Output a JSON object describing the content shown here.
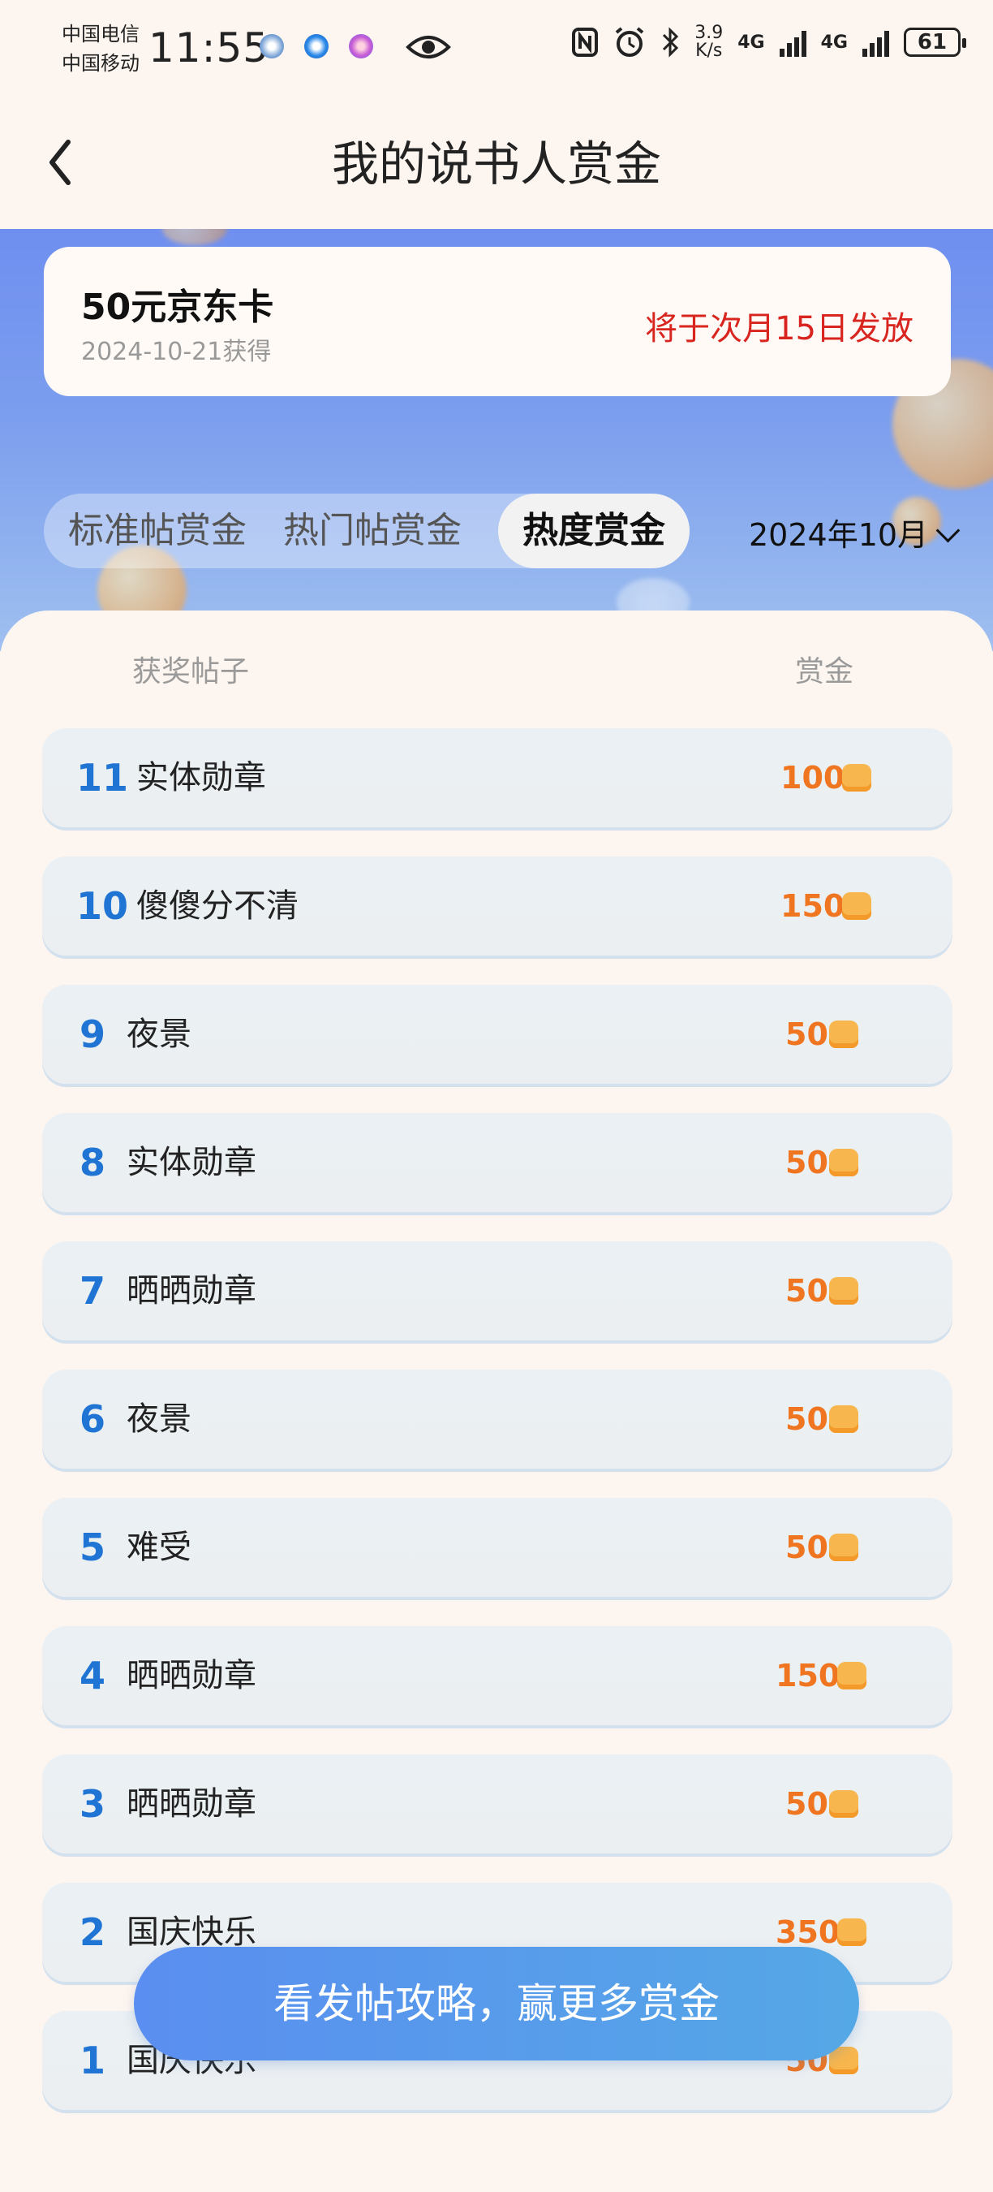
{
  "status_bar": {
    "carrier_1": "中国电信",
    "carrier_2": "中国移动",
    "time": "11:55",
    "net_speed_value": "3.9",
    "net_speed_unit": "K/s",
    "network_1": "4G",
    "network_2": "4G",
    "battery": "61"
  },
  "header": {
    "title": "我的说书人赏金"
  },
  "prize_card": {
    "title": "50元京东卡",
    "date": "2024-10-21获得",
    "status": "将于次月15日发放"
  },
  "tabs": [
    {
      "label": "标准帖赏金",
      "active": false
    },
    {
      "label": "热门帖赏金",
      "active": false
    },
    {
      "label": "热度赏金",
      "active": true
    }
  ],
  "month_selector": "2024年10月",
  "table_headers": {
    "post": "获奖帖子",
    "reward": "赏金"
  },
  "rows": [
    {
      "rank": "11",
      "title": "实体勋章",
      "reward": "100"
    },
    {
      "rank": "10",
      "title": "傻傻分不清",
      "reward": "150"
    },
    {
      "rank": "9",
      "title": "夜景",
      "reward": "50"
    },
    {
      "rank": "8",
      "title": "实体勋章",
      "reward": "50"
    },
    {
      "rank": "7",
      "title": "晒晒勋章",
      "reward": "50"
    },
    {
      "rank": "6",
      "title": "夜景",
      "reward": "50"
    },
    {
      "rank": "5",
      "title": "难受",
      "reward": "50"
    },
    {
      "rank": "4",
      "title": "晒晒勋章",
      "reward": "150"
    },
    {
      "rank": "3",
      "title": "晒晒勋章",
      "reward": "50"
    },
    {
      "rank": "2",
      "title": "国庆快乐",
      "reward": "350"
    },
    {
      "rank": "1",
      "title": "国庆快乐",
      "reward": "50"
    }
  ],
  "cta_button": "看发帖攻略，赢更多赏金",
  "colors": {
    "accent_blue": "#1f74d4",
    "reward_orange": "#f07520",
    "status_red": "#d8251f"
  }
}
